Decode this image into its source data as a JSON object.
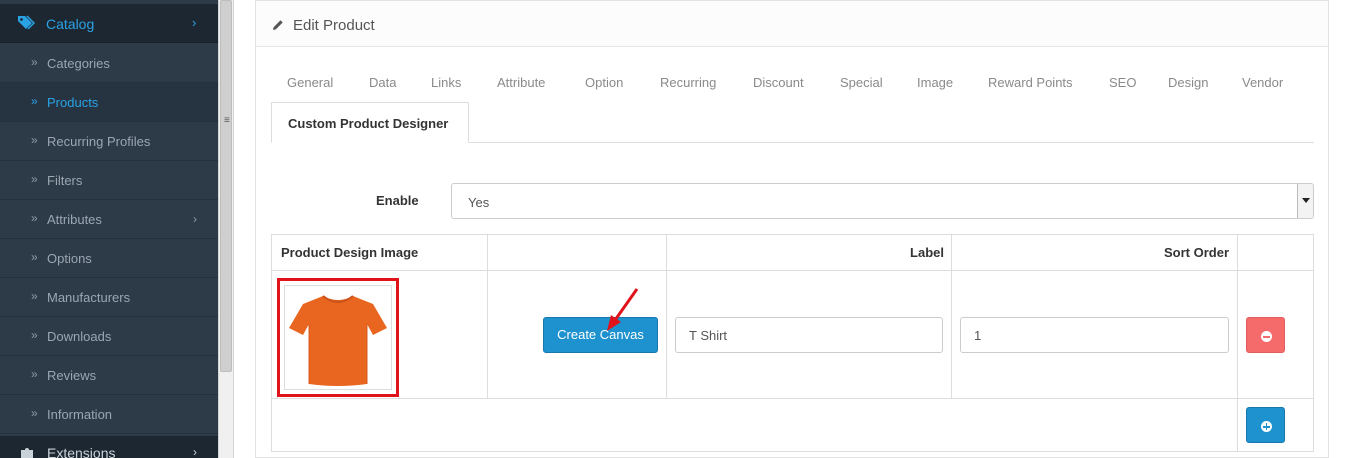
{
  "sidebar": {
    "catalog_label": "Catalog",
    "items": [
      {
        "label": "Categories"
      },
      {
        "label": "Products"
      },
      {
        "label": "Recurring Profiles"
      },
      {
        "label": "Filters"
      },
      {
        "label": "Attributes"
      },
      {
        "label": "Options"
      },
      {
        "label": "Manufacturers"
      },
      {
        "label": "Downloads"
      },
      {
        "label": "Reviews"
      },
      {
        "label": "Information"
      }
    ],
    "extensions_label": "Extensions",
    "active_item": "Products",
    "accent_color": "#2aa3e6"
  },
  "panel": {
    "title": "Edit Product",
    "tabs": [
      "General",
      "Data",
      "Links",
      "Attribute",
      "Option",
      "Recurring",
      "Discount",
      "Special",
      "Image",
      "Reward Points",
      "SEO",
      "Design",
      "Vendor"
    ],
    "active_tab": "Custom Product Designer"
  },
  "enable": {
    "label": "Enable",
    "value": "Yes"
  },
  "table": {
    "headers": {
      "image": "Product Design Image",
      "blank": "",
      "label": "Label",
      "sort_order": "Sort Order"
    },
    "row": {
      "image_icon": "orange-tshirt",
      "create_button": "Create Canvas",
      "label_value": "T Shirt",
      "sort_value": "1"
    }
  },
  "colors": {
    "primary_button": "#1e91cf",
    "danger_button": "#f56b6b",
    "highlight_border": "#e0131a"
  }
}
